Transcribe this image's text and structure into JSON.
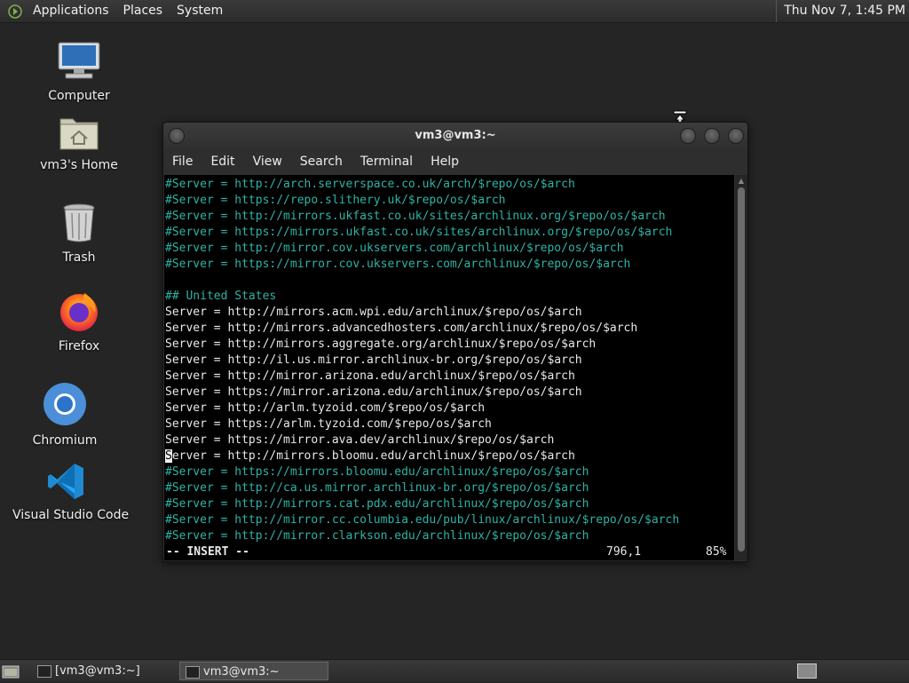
{
  "top_panel": {
    "menus": [
      "Applications",
      "Places",
      "System"
    ],
    "clock": "Thu Nov  7,  1:45 PM"
  },
  "desktop": {
    "icons": [
      {
        "label": "Computer",
        "icon": "computer-icon"
      },
      {
        "label": "vm3's Home",
        "icon": "home-folder-icon"
      },
      {
        "label": "Trash",
        "icon": "trash-icon"
      },
      {
        "label": "Firefox",
        "icon": "firefox-icon"
      },
      {
        "label": "Chromium",
        "icon": "chromium-icon"
      },
      {
        "label": "Visual Studio Code",
        "icon": "vscode-icon"
      }
    ]
  },
  "window": {
    "title": "vm3@vm3:~",
    "menu": [
      "File",
      "Edit",
      "View",
      "Search",
      "Terminal",
      "Help"
    ]
  },
  "terminal": {
    "lines": [
      {
        "text": "#Server = http://arch.serverspace.co.uk/arch/$repo/os/$arch",
        "style": "comment"
      },
      {
        "text": "#Server = https://repo.slithery.uk/$repo/os/$arch",
        "style": "comment"
      },
      {
        "text": "#Server = http://mirrors.ukfast.co.uk/sites/archlinux.org/$repo/os/$arch",
        "style": "comment"
      },
      {
        "text": "#Server = https://mirrors.ukfast.co.uk/sites/archlinux.org/$repo/os/$arch",
        "style": "comment"
      },
      {
        "text": "#Server = http://mirror.cov.ukservers.com/archlinux/$repo/os/$arch",
        "style": "comment"
      },
      {
        "text": "#Server = https://mirror.cov.ukservers.com/archlinux/$repo/os/$arch",
        "style": "comment"
      },
      {
        "text": "",
        "style": "plain"
      },
      {
        "text": "## United States",
        "style": "comment"
      },
      {
        "text": "Server = http://mirrors.acm.wpi.edu/archlinux/$repo/os/$arch",
        "style": "plain"
      },
      {
        "text": "Server = http://mirrors.advancedhosters.com/archlinux/$repo/os/$arch",
        "style": "plain"
      },
      {
        "text": "Server = http://mirrors.aggregate.org/archlinux/$repo/os/$arch",
        "style": "plain"
      },
      {
        "text": "Server = http://il.us.mirror.archlinux-br.org/$repo/os/$arch",
        "style": "plain"
      },
      {
        "text": "Server = http://mirror.arizona.edu/archlinux/$repo/os/$arch",
        "style": "plain"
      },
      {
        "text": "Server = https://mirror.arizona.edu/archlinux/$repo/os/$arch",
        "style": "plain"
      },
      {
        "text": "Server = http://arlm.tyzoid.com/$repo/os/$arch",
        "style": "plain"
      },
      {
        "text": "Server = https://arlm.tyzoid.com/$repo/os/$arch",
        "style": "plain"
      },
      {
        "text": "Server = https://mirror.ava.dev/archlinux/$repo/os/$arch",
        "style": "plain"
      },
      {
        "text": "Server = http://mirrors.bloomu.edu/archlinux/$repo/os/$arch",
        "style": "cursor"
      },
      {
        "text": "#Server = https://mirrors.bloomu.edu/archlinux/$repo/os/$arch",
        "style": "comment"
      },
      {
        "text": "#Server = http://ca.us.mirror.archlinux-br.org/$repo/os/$arch",
        "style": "comment"
      },
      {
        "text": "#Server = http://mirrors.cat.pdx.edu/archlinux/$repo/os/$arch",
        "style": "comment"
      },
      {
        "text": "#Server = http://mirror.cc.columbia.edu/pub/linux/archlinux/$repo/os/$arch",
        "style": "comment"
      },
      {
        "text": "#Server = http://mirror.clarkson.edu/archlinux/$repo/os/$arch",
        "style": "comment"
      }
    ],
    "status": {
      "mode": "-- INSERT --",
      "position": "796,1",
      "percent": "85%"
    }
  },
  "taskbar": {
    "tasks": [
      {
        "label": "[vm3@vm3:~]",
        "active": false
      },
      {
        "label": "vm3@vm3:~",
        "active": true
      }
    ]
  }
}
